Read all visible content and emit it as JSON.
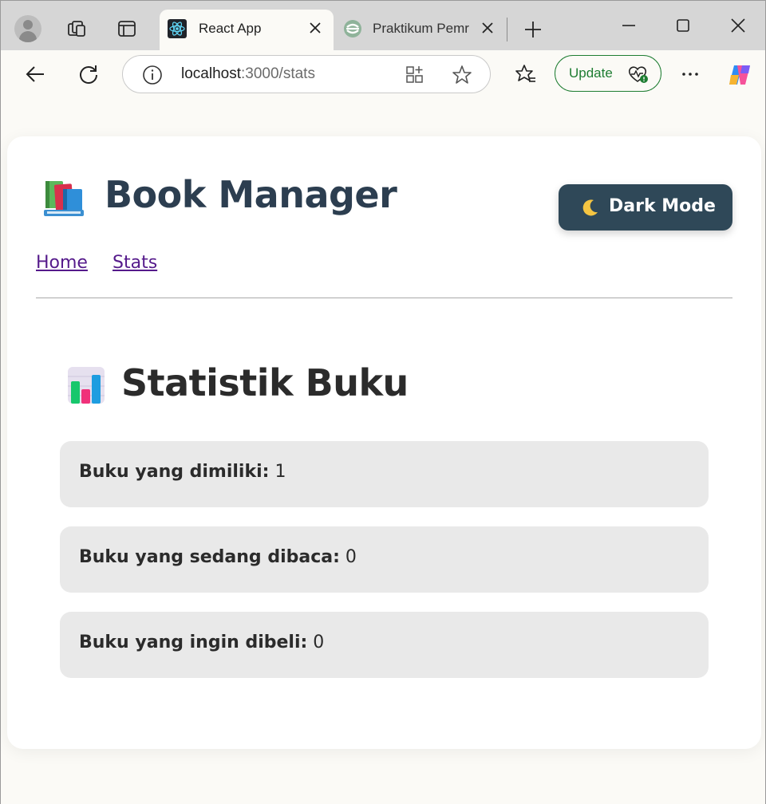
{
  "browser": {
    "tabs": [
      {
        "title": "React App",
        "active": true
      },
      {
        "title": "Praktikum Pemr",
        "active": false
      }
    ],
    "url_host": "localhost",
    "url_path": ":3000/stats",
    "update_label": "Update",
    "colors": {
      "update_accent": "#1e7d32",
      "tabstrip": "#d6d6d6"
    }
  },
  "app": {
    "title": "Book Manager",
    "dark_mode_label": "Dark Mode",
    "nav": [
      {
        "label": "Home"
      },
      {
        "label": "Stats"
      }
    ],
    "colors": {
      "title": "#2c3e50",
      "button_bg": "#2f4858",
      "link": "#551a8b"
    }
  },
  "stats": {
    "heading": "Statistik Buku",
    "items": [
      {
        "label": "Buku yang dimiliki:",
        "value": "1"
      },
      {
        "label": "Buku yang sedang dibaca:",
        "value": "0"
      },
      {
        "label": "Buku yang ingin dibeli:",
        "value": "0"
      }
    ]
  },
  "icons": [
    "profile-icon",
    "workspaces-icon",
    "tab-actions-icon",
    "react-favicon-icon",
    "site-favicon-icon",
    "close-icon",
    "new-tab-icon",
    "minimize-icon",
    "maximize-icon",
    "window-close-icon",
    "back-icon",
    "refresh-icon",
    "info-icon",
    "apps-icon",
    "favorite-star-icon",
    "favorites-icon",
    "heart-pulse-icon",
    "more-icon",
    "copilot-icon",
    "books-icon",
    "moon-icon",
    "bar-chart-icon"
  ]
}
